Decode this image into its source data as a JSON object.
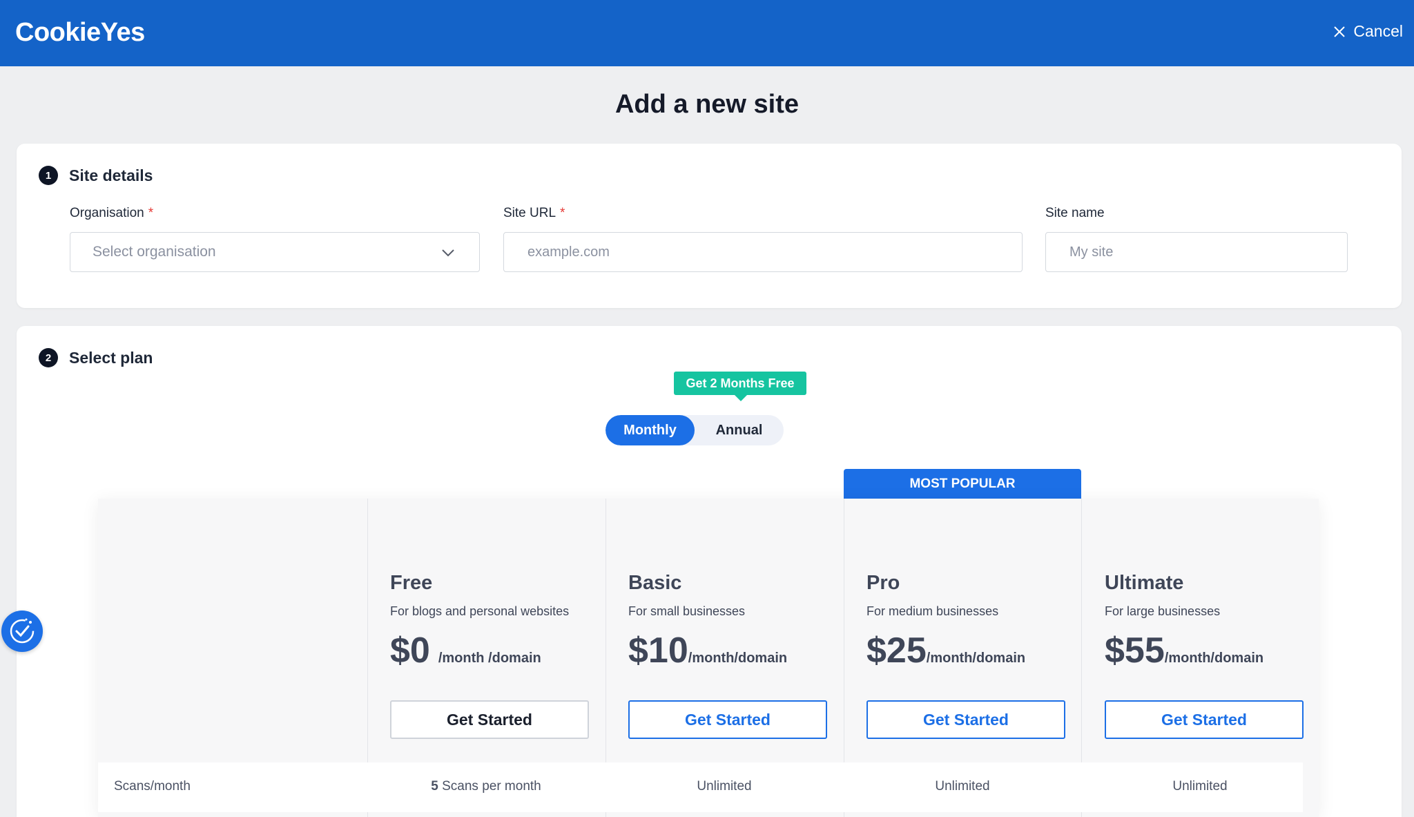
{
  "header": {
    "logo_text": "CookieYes",
    "cancel_label": "Cancel"
  },
  "page": {
    "title": "Add a new site"
  },
  "site_details": {
    "step_number": "1",
    "heading": "Site details",
    "organisation_label": "Organisation",
    "organisation_placeholder": "Select organisation",
    "site_url_label": "Site URL",
    "site_url_placeholder": "example.com",
    "site_name_label": "Site name",
    "site_name_placeholder": "My site",
    "required_mark": "*"
  },
  "select_plan": {
    "step_number": "2",
    "heading": "Select plan",
    "promo": "Get 2 Months Free",
    "billing_options": [
      "Monthly",
      "Annual"
    ],
    "selected_billing": "Monthly",
    "most_popular": "MOST POPULAR"
  },
  "plans": [
    {
      "name": "Free",
      "desc": "For blogs and personal websites",
      "price": "$0",
      "per": " /month /domain",
      "cta": "Get Started",
      "scans_bold": "5",
      "scans_text": " Scans per month"
    },
    {
      "name": "Basic",
      "desc": "For small businesses",
      "price": "$10",
      "per": "/month/domain",
      "cta": "Get Started",
      "scans_text": "Unlimited"
    },
    {
      "name": "Pro",
      "desc": "For medium businesses",
      "price": "$25",
      "per": "/month/domain",
      "cta": "Get Started",
      "scans_text": "Unlimited"
    },
    {
      "name": "Ultimate",
      "desc": "For large businesses",
      "price": "$55",
      "per": "/month/domain",
      "cta": "Get Started",
      "scans_text": "Unlimited"
    }
  ],
  "features": {
    "scans_label": "Scans/month"
  },
  "colors": {
    "header_blue": "#1463c8",
    "accent_blue": "#1c6fe6",
    "promo_green": "#16c4a0",
    "required_red": "#e53935"
  }
}
